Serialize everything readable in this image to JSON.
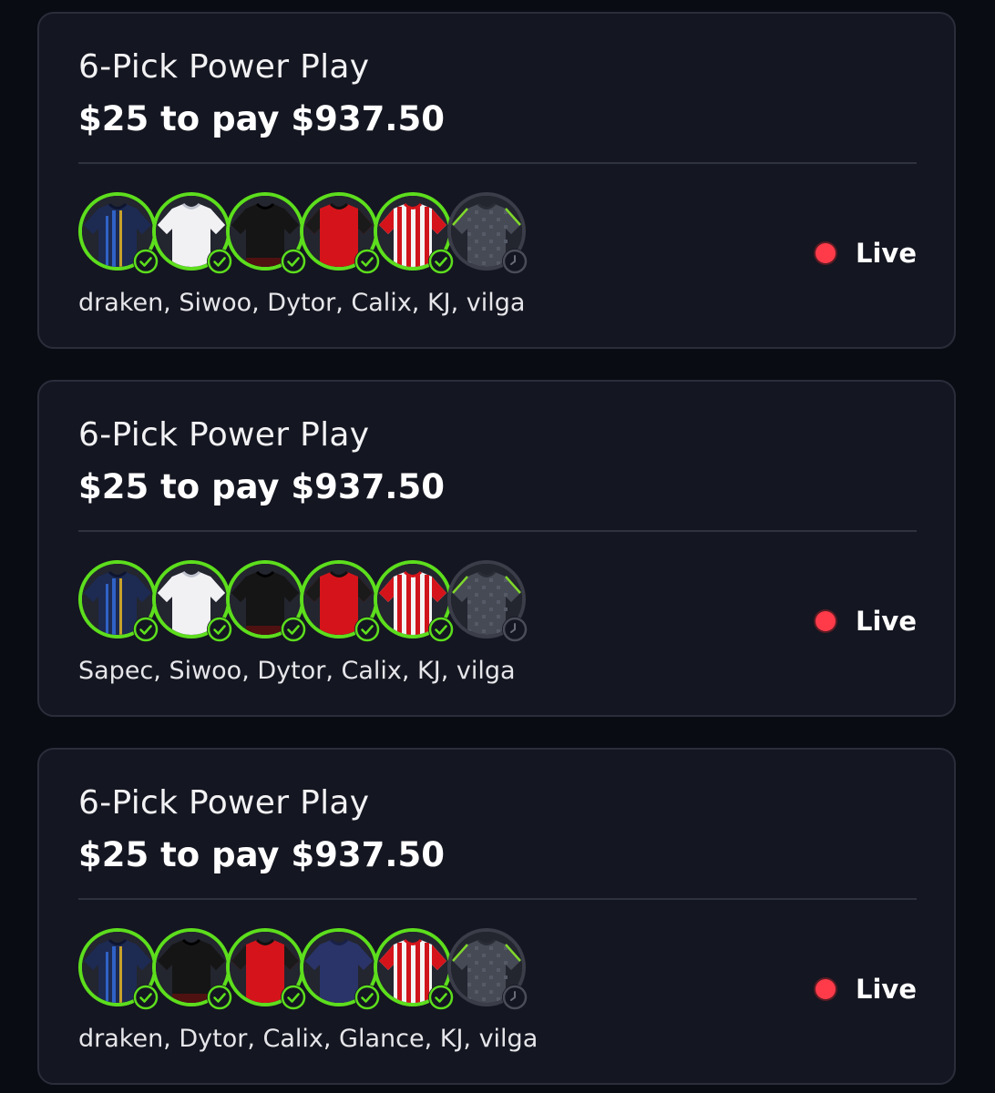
{
  "colors": {
    "background": "#0a0c14",
    "card": "#141621",
    "win_ring": "#5dde1d",
    "live_dot": "#ff3b4a"
  },
  "cards": [
    {
      "title": "6-Pick Power Play",
      "amount": "$25 to pay $937.50",
      "picks": [
        {
          "jersey": "navy-blue-gold-stripes",
          "state": "won",
          "icon": "check-icon"
        },
        {
          "jersey": "white",
          "state": "won",
          "icon": "check-icon"
        },
        {
          "jersey": "black",
          "state": "won",
          "icon": "check-icon"
        },
        {
          "jersey": "red-black-sleeves",
          "state": "won",
          "icon": "check-icon"
        },
        {
          "jersey": "red-white-stripes",
          "state": "won",
          "icon": "check-icon"
        },
        {
          "jersey": "grey-checker-green-trim",
          "state": "pending",
          "icon": "clock-icon"
        }
      ],
      "players": "draken, Siwoo, Dytor, Calix, KJ, vilga",
      "status": "Live"
    },
    {
      "title": "6-Pick Power Play",
      "amount": "$25 to pay $937.50",
      "picks": [
        {
          "jersey": "navy-blue-gold-stripes",
          "state": "won",
          "icon": "check-icon"
        },
        {
          "jersey": "white",
          "state": "won",
          "icon": "check-icon"
        },
        {
          "jersey": "black",
          "state": "won",
          "icon": "check-icon"
        },
        {
          "jersey": "red-black-sleeves",
          "state": "won",
          "icon": "check-icon"
        },
        {
          "jersey": "red-white-stripes",
          "state": "won",
          "icon": "check-icon"
        },
        {
          "jersey": "grey-checker-green-trim",
          "state": "pending",
          "icon": "clock-icon"
        }
      ],
      "players": "Sapec, Siwoo, Dytor, Calix, KJ, vilga",
      "status": "Live"
    },
    {
      "title": "6-Pick Power Play",
      "amount": "$25 to pay $937.50",
      "picks": [
        {
          "jersey": "navy-blue-gold-stripes",
          "state": "won",
          "icon": "check-icon"
        },
        {
          "jersey": "black",
          "state": "won",
          "icon": "check-icon"
        },
        {
          "jersey": "red-black-sleeves",
          "state": "won",
          "icon": "check-icon"
        },
        {
          "jersey": "navy",
          "state": "won",
          "icon": "check-icon"
        },
        {
          "jersey": "red-white-stripes",
          "state": "won",
          "icon": "check-icon"
        },
        {
          "jersey": "grey-checker-green-trim",
          "state": "pending",
          "icon": "clock-icon"
        }
      ],
      "players": "draken, Dytor, Calix, Glance, KJ, vilga",
      "status": "Live"
    }
  ]
}
